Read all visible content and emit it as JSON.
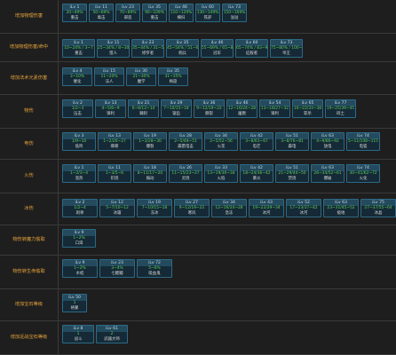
{
  "colors": {
    "background": "#1e1e1e",
    "label_text": "#e8a43c",
    "range_text": "#5fd35f",
    "cell_bg": "#1c3a4c",
    "cell_border": "#2c6a86"
  },
  "rows": [
    {
      "label": "增加物理伤害",
      "cells": [
        {
          "lv": "iLv 1",
          "range": "20~49%",
          "name": "重击"
        },
        {
          "lv": "iLv 11",
          "range": "50~69%",
          "name": "毒击"
        },
        {
          "lv": "iLv 23",
          "range": "70~89%",
          "name": "邪恶"
        },
        {
          "lv": "iLv 35",
          "range": "90~109%",
          "name": "重击"
        },
        {
          "lv": "iLv 46",
          "range": "110~129%",
          "name": "横扫"
        },
        {
          "lv": "iLv 60",
          "range": "130~149%",
          "name": "铁驴"
        },
        {
          "lv": "iLv 73",
          "range": "150~169%",
          "name": "溢溢"
        }
      ]
    },
    {
      "label": "增加物理伤害/命中",
      "cells": [
        {
          "lv": "iLv 1",
          "range": "10~24% / 3~7",
          "name": "重击"
        },
        {
          "lv": "iLv 11",
          "range": "25~34% / 8~30",
          "name": "猎人"
        },
        {
          "lv": "iLv 23",
          "range": "35~44% / 31~50",
          "name": "修罗者"
        },
        {
          "lv": "iLv 35",
          "range": "45~54% / 51~64",
          "name": "佣兵"
        },
        {
          "lv": "iLv 46",
          "range": "55~69% / 65~82",
          "name": "冠军"
        },
        {
          "lv": "iLv 60",
          "range": "65~74% / 83~99",
          "name": "征服者"
        },
        {
          "lv": "iLv 73",
          "range": "75~80% / 100~135",
          "name": "帝王"
        }
      ]
    },
    {
      "label": "增加法术元素伤害",
      "cells": [
        {
          "lv": "iLv 4",
          "range": "3~10%",
          "name": "催化"
        },
        {
          "lv": "iLv 15",
          "range": "11~20%",
          "name": "法人"
        },
        {
          "lv": "iLv 30",
          "range": "21~30%",
          "name": "魔学"
        },
        {
          "lv": "iLv 35",
          "range": "31~35%",
          "name": "梅旋"
        }
      ]
    },
    {
      "label": "物伤",
      "cells": [
        {
          "lv": "iLv 2",
          "range": "1/2~3",
          "name": "压击"
        },
        {
          "lv": "iLv 13",
          "range": "4~5/6~9",
          "name": "锋利"
        },
        {
          "lv": "iLv 21",
          "range": "6~8/12~14",
          "name": "棘刺"
        },
        {
          "lv": "iLv 29",
          "range": "7~10/15~18",
          "name": "锯齿"
        },
        {
          "lv": "iLv 36",
          "range": "9~12/19~22",
          "name": "撕裂"
        },
        {
          "lv": "iLv 46",
          "range": "12~16/24~28",
          "name": "屠戮"
        },
        {
          "lv": "iLv 54",
          "range": "13~18/27~32",
          "name": "锋利"
        },
        {
          "lv": "iLv 65",
          "range": "16~22/33~38",
          "name": "斩杀"
        },
        {
          "lv": "iLv 77",
          "range": "19~25/39~45",
          "name": "碎土"
        }
      ]
    },
    {
      "label": "电伤",
      "cells": [
        {
          "lv": "iLv 3",
          "range": "1/9~10",
          "name": "低鸣"
        },
        {
          "lv": "iLv 13",
          "range": "1~2/26~27",
          "name": "嘶嘶"
        },
        {
          "lv": "iLv 19",
          "range": "1~3/28~30",
          "name": "爆裂"
        },
        {
          "lv": "iLv 28",
          "range": "2~5/48~51",
          "name": "霹雳电击"
        },
        {
          "lv": "iLv 34",
          "range": "2~5/52~56",
          "name": "火花"
        },
        {
          "lv": "iLv 42",
          "range": "3~8/63~67",
          "name": "电芒"
        },
        {
          "lv": "iLv 51",
          "range": "3~8/76~81",
          "name": "霹电"
        },
        {
          "lv": "iLv 63",
          "range": "4~9/86~92",
          "name": "放电"
        },
        {
          "lv": "iLv 74",
          "range": "5~11/108~115",
          "name": "电弧"
        }
      ]
    },
    {
      "label": "火伤",
      "cells": [
        {
          "lv": "iLv 1",
          "range": "1~2/3~4",
          "name": "温热"
        },
        {
          "lv": "iLv 11",
          "range": "1~3/5~6",
          "name": "炽烧"
        },
        {
          "lv": "iLv 18",
          "range": "8~11/17~20",
          "name": "煽动"
        },
        {
          "lv": "iLv 26",
          "range": "11~15/23~27",
          "name": "灵烧"
        },
        {
          "lv": "iLv 33",
          "range": "13~19/30~34",
          "name": "火焰"
        },
        {
          "lv": "iLv 42",
          "range": "18~24/36~42",
          "name": "暴炎"
        },
        {
          "lv": "iLv 51",
          "range": "21~29/44~50",
          "name": "焚烧"
        },
        {
          "lv": "iLv 63",
          "range": "26~34/52~61",
          "name": "爆破"
        },
        {
          "lv": "iLv 74",
          "range": "30~41/62~72",
          "name": "火化"
        }
      ]
    },
    {
      "label": "冰伤",
      "cells": [
        {
          "lv": "iLv 2",
          "range": "1/2~4",
          "name": "刺骨"
        },
        {
          "lv": "iLv 12",
          "range": "5~7/10~12",
          "name": "冰霜"
        },
        {
          "lv": "iLv 19",
          "range": "7~10/15~18",
          "name": "冻冰"
        },
        {
          "lv": "iLv 27",
          "range": "9~12/19~22",
          "name": "寒风"
        },
        {
          "lv": "iLv 34",
          "range": "12~16/24~28",
          "name": "急冻"
        },
        {
          "lv": "iLv 43",
          "range": "19~22/29~34",
          "name": "冰河"
        },
        {
          "lv": "iLv 52",
          "range": "17~23/37~42",
          "name": "冰河"
        },
        {
          "lv": "iLv 63",
          "range": "23~31/45~52",
          "name": "极地"
        },
        {
          "lv": "iLv 75",
          "range": "27~37/55~64",
          "name": "冰晶"
        }
      ]
    },
    {
      "label": "物伤转魔力偷取",
      "cells": [
        {
          "lv": "iLv 9",
          "range": "1~2%",
          "name": "口渴"
        }
      ]
    },
    {
      "label": "物伤转生命偷取",
      "cells": [
        {
          "lv": "iLv 9",
          "range": "1~2%",
          "name": "水蛭"
        },
        {
          "lv": "iLv 23",
          "range": "3~4%",
          "name": "七鳃鳗"
        },
        {
          "lv": "iLv 72",
          "range": "5~6%",
          "name": "吸血鬼"
        }
      ]
    },
    {
      "label": "增加宝石等级",
      "cells": [
        {
          "lv": "iLv 50",
          "range": "1",
          "name": "格蒙"
        }
      ]
    },
    {
      "label": "增加近战宝石等级",
      "cells": [
        {
          "lv": "iLv 8",
          "range": "1",
          "name": "战斗"
        },
        {
          "lv": "iLv 61",
          "range": "2",
          "name": "武器大师"
        }
      ]
    }
  ]
}
